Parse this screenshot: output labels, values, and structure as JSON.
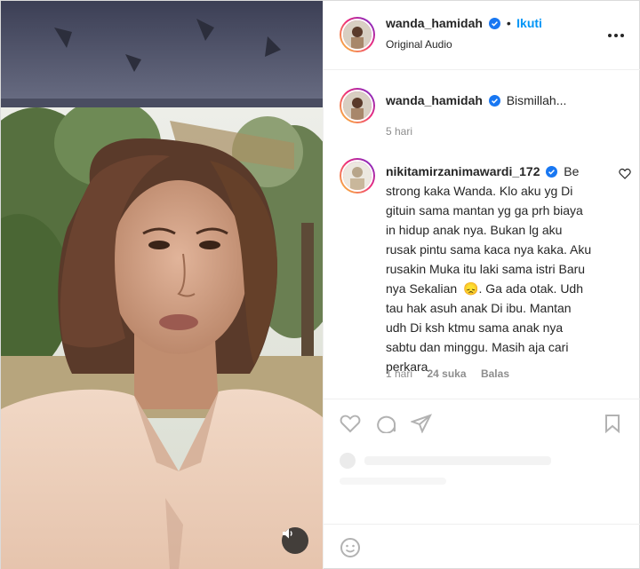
{
  "post": {
    "author": "wanda_hamidah",
    "follow_label": "Ikuti",
    "audio_label": "Original Audio"
  },
  "caption": {
    "username": "wanda_hamidah",
    "text": "Bismillah...",
    "time": "5 hari"
  },
  "comment": {
    "username": "nikitamirzanimawardi_172",
    "lines": [
      "Be",
      "strong kaka Wanda. Klo aku yg Di",
      "gituin sama mantan yg ga prh biaya",
      "in hidup anak nya. Bukan lg aku",
      "rusak pintu sama kaca nya kaka. Aku",
      "rusakin Muka itu laki sama istri Baru",
      "nya Sekalian",
      ". Ga ada otak. Udh",
      "tau hak asuh anak Di ibu. Mantan",
      "udh Di ksh ktmu sama anak nya",
      "sabtu dan minggu. Masih aja cari",
      "perkara."
    ],
    "emoji": "😞",
    "time": "1 hari",
    "likes": "24 suka",
    "reply_label": "Balas"
  },
  "icons": {
    "more": "more-horizontal-icon",
    "like": "heart-icon",
    "comment": "comment-icon",
    "share": "send-icon",
    "save": "bookmark-icon",
    "audio": "speaker-icon",
    "verified": "verified-badge-icon"
  },
  "colors": {
    "link": "#0095f6",
    "verified": "#1877f2",
    "muted": "#8e8e8e"
  }
}
